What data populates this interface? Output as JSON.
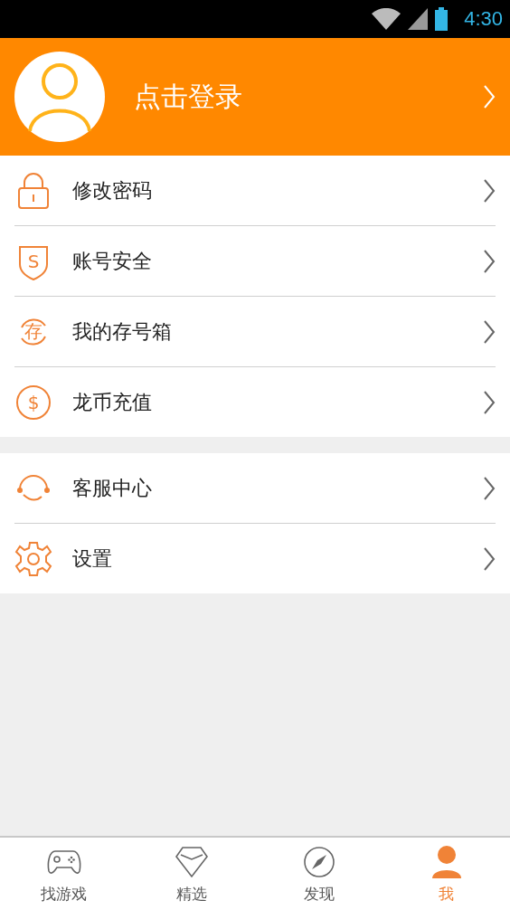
{
  "status_bar": {
    "time": "4:30"
  },
  "header": {
    "login_label": "点击登录"
  },
  "menu_groups": [
    [
      {
        "label": "修改密码"
      },
      {
        "label": "账号安全",
        "icon_glyph": "S"
      },
      {
        "label": "我的存号箱",
        "icon_glyph": "存"
      },
      {
        "label": "龙币充值",
        "icon_glyph": "$"
      }
    ],
    [
      {
        "label": "客服中心"
      },
      {
        "label": "设置"
      }
    ]
  ],
  "bottom_nav": [
    {
      "label": "找游戏",
      "selected": false
    },
    {
      "label": "精选",
      "selected": false
    },
    {
      "label": "发现",
      "selected": false
    },
    {
      "label": "我",
      "selected": true
    }
  ]
}
